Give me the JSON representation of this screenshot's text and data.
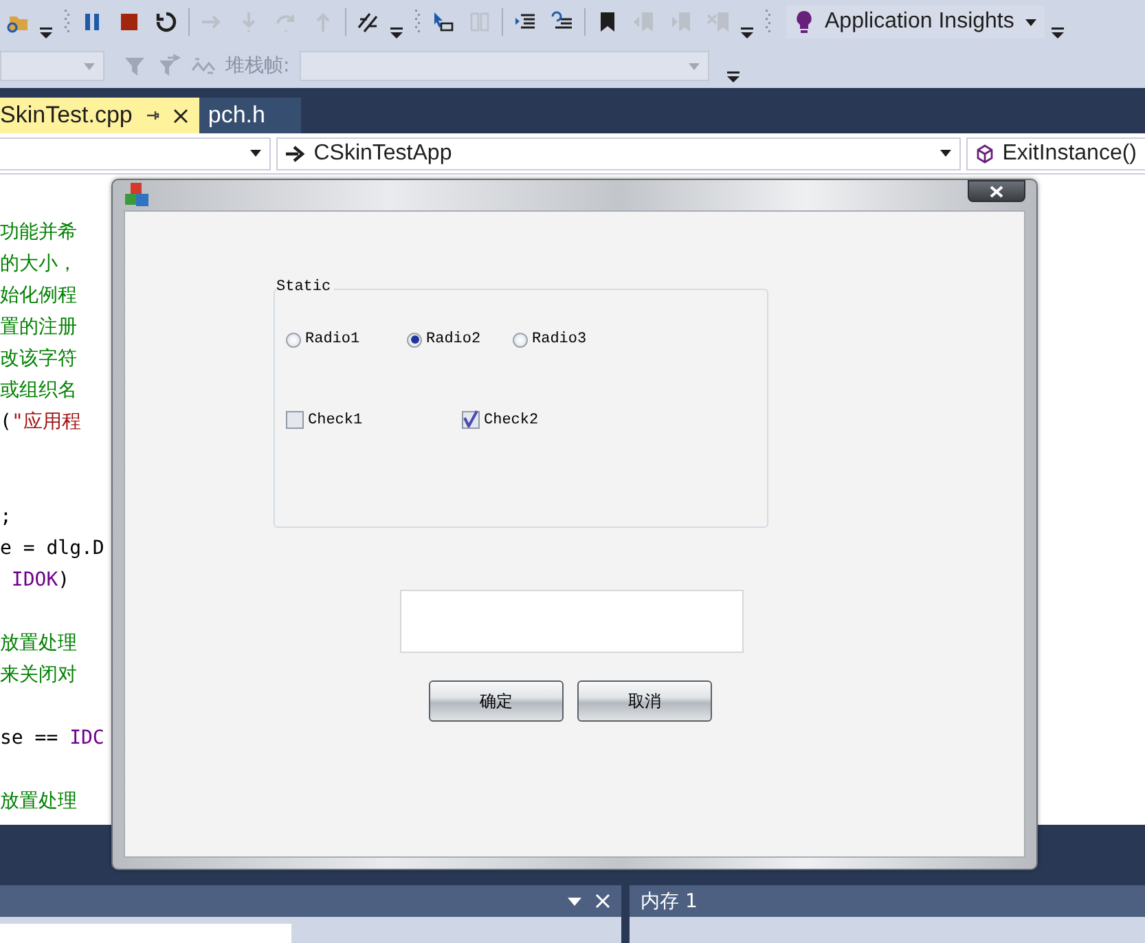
{
  "toolbar": {
    "items": [
      {
        "kind": "folder-search",
        "disabled": false
      },
      {
        "kind": "overflow"
      },
      {
        "kind": "grip"
      },
      {
        "kind": "pause",
        "disabled": false
      },
      {
        "kind": "stop",
        "disabled": false
      },
      {
        "kind": "restart",
        "disabled": false
      },
      {
        "kind": "separator"
      },
      {
        "kind": "show-next",
        "disabled": true
      },
      {
        "kind": "step-into",
        "disabled": true
      },
      {
        "kind": "step-over",
        "disabled": true
      },
      {
        "kind": "step-out",
        "disabled": true
      },
      {
        "kind": "separator"
      },
      {
        "kind": "threads",
        "disabled": false
      },
      {
        "kind": "overflow"
      },
      {
        "kind": "grip"
      },
      {
        "kind": "pointer",
        "disabled": false
      },
      {
        "kind": "columns",
        "disabled": true
      },
      {
        "kind": "separator"
      },
      {
        "kind": "indent",
        "disabled": false
      },
      {
        "kind": "comment",
        "disabled": false
      },
      {
        "kind": "separator"
      },
      {
        "kind": "bookmark",
        "disabled": false
      },
      {
        "kind": "bookmark-prev",
        "disabled": true
      },
      {
        "kind": "bookmark-next",
        "disabled": true
      },
      {
        "kind": "bookmark-clear",
        "disabled": true
      },
      {
        "kind": "overflow"
      },
      {
        "kind": "grip"
      }
    ],
    "insights": "Application Insights"
  },
  "debug_bar": {
    "stack_frame_label": "堆栈帧:"
  },
  "tabs": [
    {
      "label": "SkinTest.cpp",
      "selected": true
    },
    {
      "label": "pch.h",
      "selected": false
    }
  ],
  "nav": {
    "scope": "CSkinTestApp",
    "member": "ExitInstance()"
  },
  "code_lines": [
    {
      "kind": "line",
      "segments": [
        {
          "text": "功能并希",
          "kind": "comment"
        }
      ]
    },
    {
      "kind": "line",
      "segments": [
        {
          "text": "的大小，",
          "kind": "comment"
        }
      ]
    },
    {
      "kind": "line",
      "segments": [
        {
          "text": "始化例程",
          "kind": "comment"
        }
      ]
    },
    {
      "kind": "line",
      "segments": [
        {
          "text": "置的注册",
          "kind": "comment"
        }
      ]
    },
    {
      "kind": "line",
      "segments": [
        {
          "text": "改该字符",
          "kind": "comment"
        }
      ]
    },
    {
      "kind": "line",
      "segments": [
        {
          "text": "或组织名",
          "kind": "comment"
        }
      ]
    },
    {
      "kind": "line",
      "segments": [
        {
          "text": "(",
          "kind": "code"
        },
        {
          "text": "\"应用程",
          "kind": "string"
        }
      ]
    },
    {
      "kind": "blank"
    },
    {
      "kind": "blank"
    },
    {
      "kind": "line",
      "segments": [
        {
          "text": ";",
          "kind": "code"
        }
      ]
    },
    {
      "kind": "line",
      "segments": [
        {
          "text": "e = dlg.D",
          "kind": "code"
        }
      ]
    },
    {
      "kind": "line",
      "segments": [
        {
          "text": " IDOK",
          "kind": "macro"
        },
        {
          "text": ")",
          "kind": "code"
        }
      ]
    },
    {
      "kind": "blank"
    },
    {
      "kind": "line",
      "segments": [
        {
          "text": "放置处理",
          "kind": "comment"
        }
      ]
    },
    {
      "kind": "line",
      "segments": [
        {
          "text": "来关闭对",
          "kind": "comment"
        }
      ]
    },
    {
      "kind": "blank"
    },
    {
      "kind": "line",
      "segments": [
        {
          "text": "se == ",
          "kind": "code"
        },
        {
          "text": "IDC",
          "kind": "macro"
        }
      ]
    },
    {
      "kind": "blank"
    },
    {
      "kind": "line",
      "segments": [
        {
          "text": "放置处理",
          "kind": "comment"
        }
      ]
    }
  ],
  "dialog": {
    "group_title": "Static",
    "radios": [
      {
        "label": "Radio1",
        "selected": false
      },
      {
        "label": "Radio2",
        "selected": true
      },
      {
        "label": "Radio3",
        "selected": false
      }
    ],
    "checks": [
      {
        "label": "Check1",
        "checked": false
      },
      {
        "label": "Check2",
        "checked": true
      }
    ],
    "buttons": [
      "确定",
      "取消"
    ]
  },
  "memory_panel": {
    "title": "内存 1"
  }
}
